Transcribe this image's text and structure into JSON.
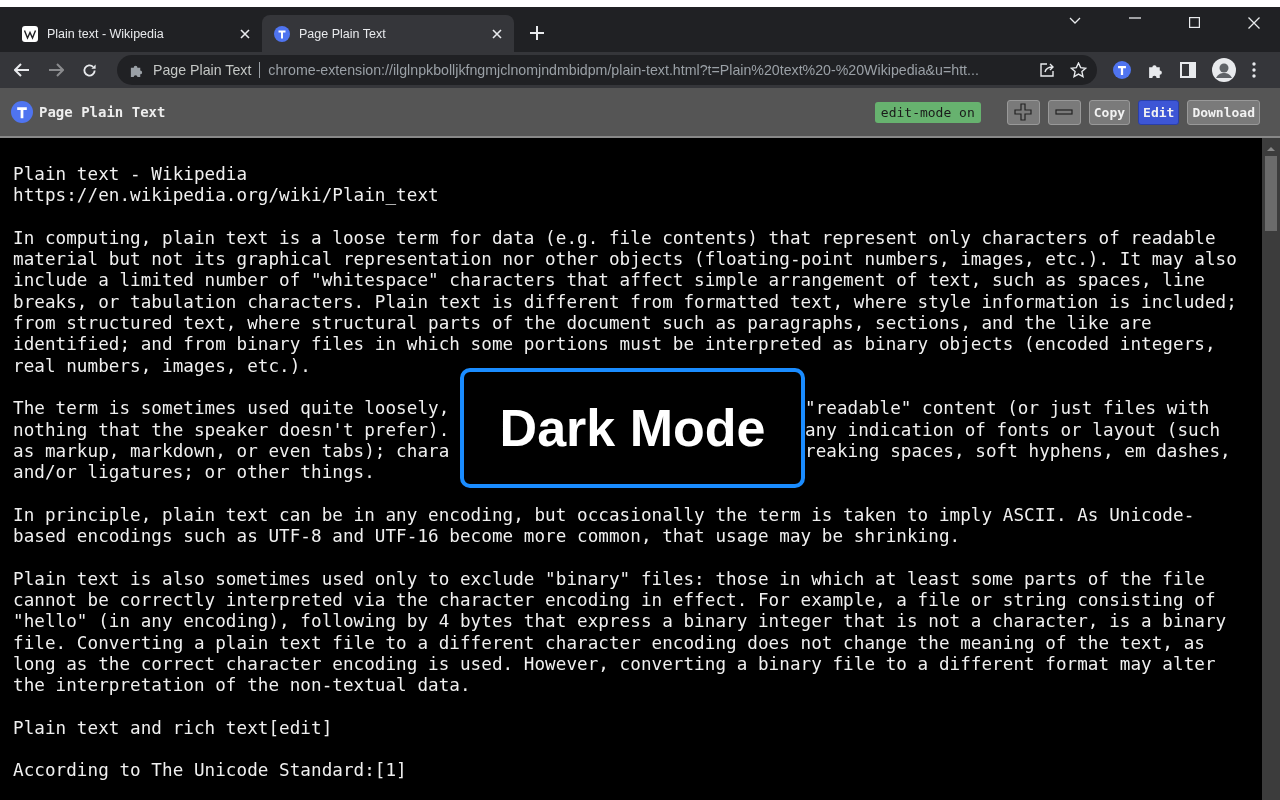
{
  "tabs": [
    {
      "title": "Plain text - Wikipedia",
      "kind": "wikipedia",
      "selected": false
    },
    {
      "title": "Page Plain Text",
      "kind": "extension",
      "selected": true
    }
  ],
  "address_bar": {
    "site_label": "Page Plain Text",
    "url": "chrome-extension://ilglnpkbolljkfngmjclnomjndmbidpm/plain-text.html?t=Plain%20text%20-%20Wikipedia&u=htt..."
  },
  "extension_bar": {
    "title": "Page Plain Text",
    "status": "edit-mode on",
    "buttons": [
      {
        "kind": "plus",
        "selected": false
      },
      {
        "kind": "minus",
        "selected": false
      },
      {
        "kind": "text",
        "label": "Copy",
        "selected": false
      },
      {
        "kind": "text",
        "label": "Edit",
        "selected": true
      },
      {
        "kind": "text",
        "label": "Download",
        "selected": false
      }
    ]
  },
  "document": {
    "paragraphs": [
      {
        "kind": "plain",
        "lines": [
          "Plain text - Wikipedia",
          "https://en.wikipedia.org/wiki/Plain_text"
        ]
      },
      {
        "kind": "plain",
        "lines": [
          "In computing, plain text is a loose term for data (e.g. file contents) that represent only characters of readable",
          "material but not its graphical representation nor other objects (floating-point numbers, images, etc.). It may also",
          "include a limited number of \"whitespace\" characters that affect simple arrangement of text, such as spaces, line",
          "breaks, or tabulation characters. Plain text is different from formatted text, where style information is included;",
          "from structured text, where structural parts of the document such as paragraphs, sections, and the like are",
          "identified; and from binary files in which some portions must be interpreted as binary objects (encoded integers,",
          "real numbers, images, etc.)."
        ]
      },
      {
        "kind": "covered",
        "lines": [
          {
            "left": "The term is sometimes used quite loosely,",
            "right": "\"readable\" content (or just files with"
          },
          {
            "left": "nothing that the speaker doesn't prefer).",
            "right": "any indication of fonts or layout (such"
          },
          {
            "left": "as markup, markdown, or even tabs); chara",
            "right": "reaking spaces, soft hyphens, em dashes,"
          },
          {
            "left": "and/or ligatures; or other things."
          }
        ]
      },
      {
        "kind": "plain",
        "lines": [
          "In principle, plain text can be in any encoding, but occasionally the term is taken to imply ASCII. As Unicode-",
          "based encodings such as UTF-8 and UTF-16 become more common, that usage may be shrinking."
        ]
      },
      {
        "kind": "plain",
        "lines": [
          "Plain text is also sometimes used only to exclude \"binary\" files: those in which at least some parts of the file",
          "cannot be correctly interpreted via the character encoding in effect. For example, a file or string consisting of",
          "\"hello\" (in any encoding), following by 4 bytes that express a binary integer that is not a character, is a binary",
          "file. Converting a plain text file to a different character encoding does not change the meaning of the text, as",
          "long as the correct character encoding is used. However, converting a binary file to a different format may alter",
          "the interpretation of the non-textual data."
        ]
      },
      {
        "kind": "plain",
        "lines": [
          "Plain text and rich text[edit]"
        ]
      },
      {
        "kind": "plain",
        "lines": [
          "According to The Unicode Standard:[1]"
        ]
      }
    ]
  },
  "overlay_label": "Dark Mode"
}
